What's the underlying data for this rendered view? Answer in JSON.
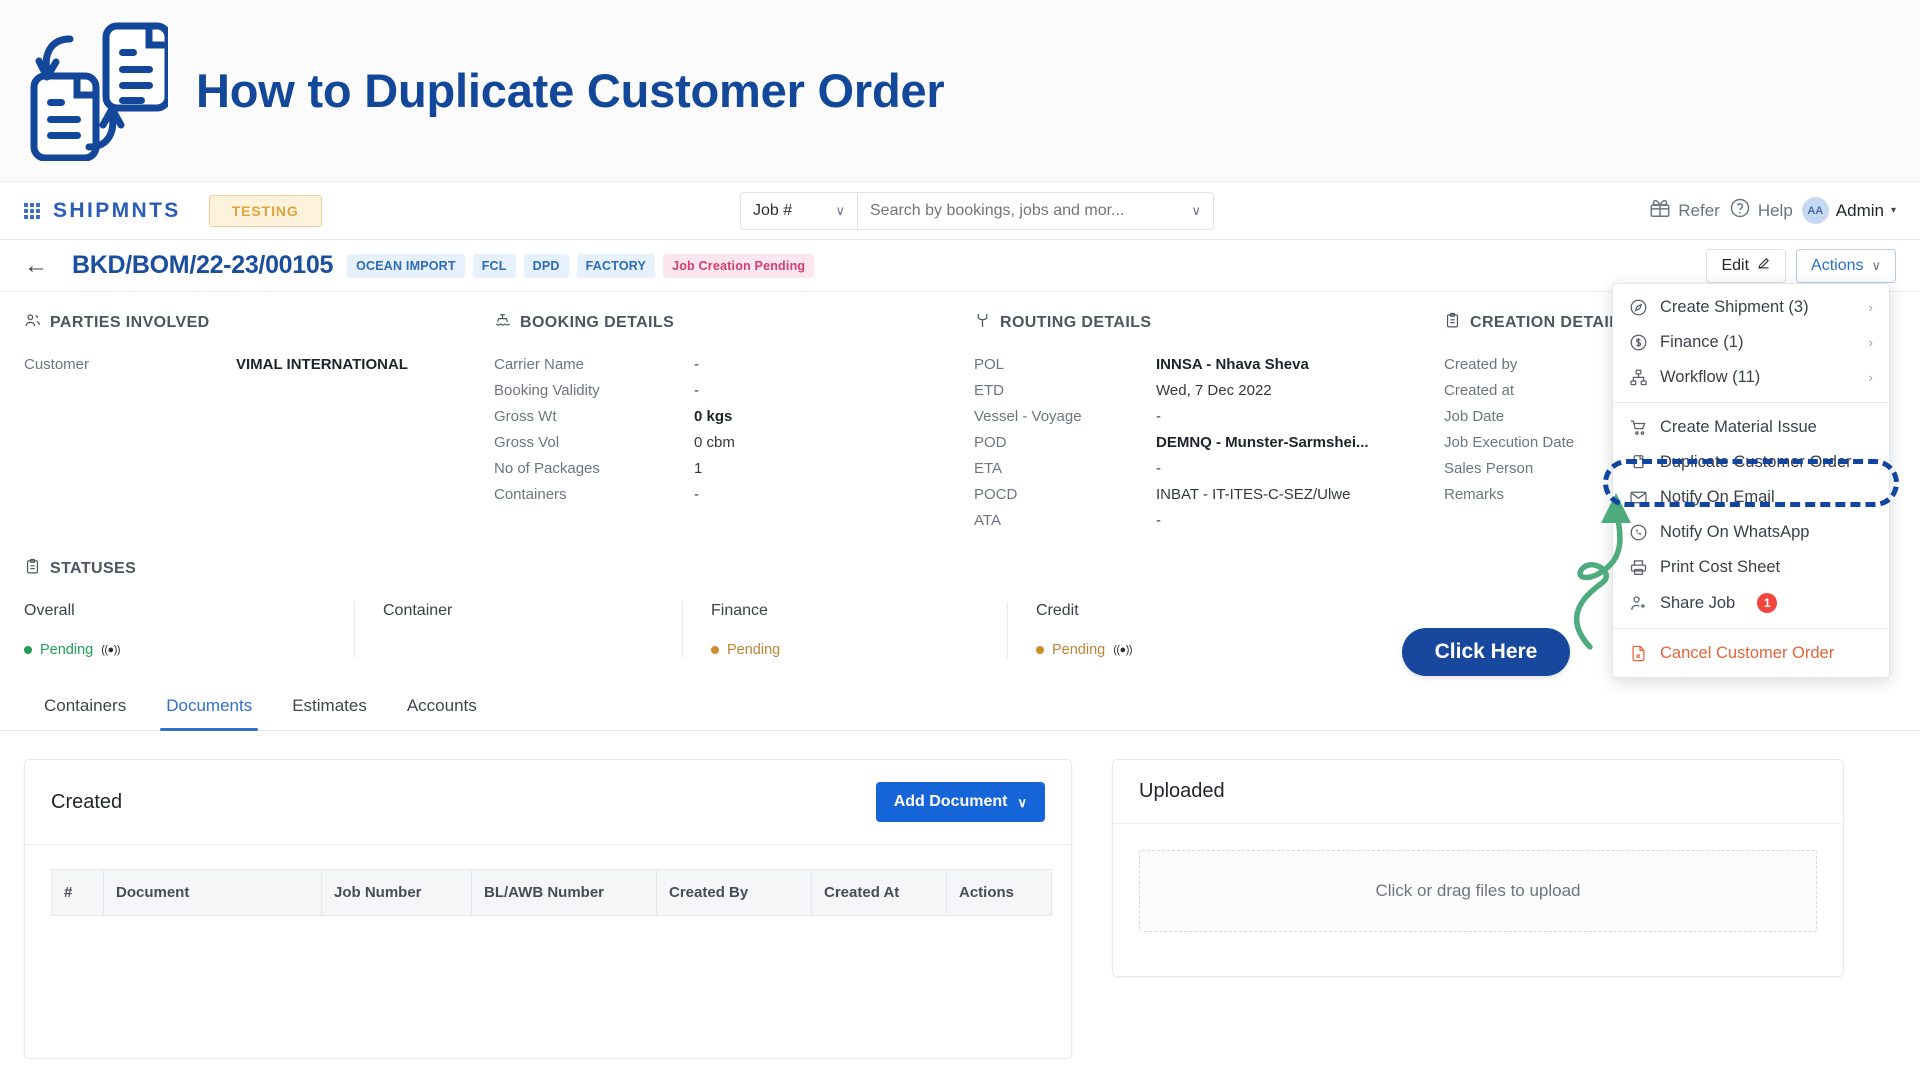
{
  "banner": {
    "title": "How to Duplicate Customer Order",
    "icon": "duplicate-documents-icon"
  },
  "topnav": {
    "apps_icon": "grid-apps-icon",
    "brand": "SHIPMNTS",
    "env_badge": "TESTING",
    "search": {
      "scope_label": "Job #",
      "scope_caret": "∨",
      "placeholder": "Search by bookings, jobs and mor...",
      "value": "",
      "caret": "∨"
    },
    "refer_label": "Refer",
    "help_label": "Help",
    "avatar_initials": "AA",
    "user_label": "Admin",
    "user_caret": "▾"
  },
  "titlebar": {
    "back_icon": "back-arrow-icon",
    "job_number": "BKD/BOM/22-23/00105",
    "tags": [
      {
        "label": "OCEAN IMPORT",
        "style": "blue"
      },
      {
        "label": "FCL",
        "style": "blue"
      },
      {
        "label": "DPD",
        "style": "blue"
      },
      {
        "label": "FACTORY",
        "style": "blue"
      },
      {
        "label": "Job Creation Pending",
        "style": "pink"
      }
    ],
    "edit_label": "Edit",
    "actions_label": "Actions",
    "actions_caret": "∨"
  },
  "parties": {
    "heading": "PARTIES INVOLVED",
    "rows": [
      {
        "key": "Customer",
        "value": "VIMAL INTERNATIONAL",
        "bold": true
      }
    ]
  },
  "booking": {
    "heading": "BOOKING DETAILS",
    "rows": [
      {
        "key": "Carrier Name",
        "value": "-",
        "bold": false
      },
      {
        "key": "Booking Validity",
        "value": "-",
        "bold": false
      },
      {
        "key": "Gross Wt",
        "value": "0 kgs",
        "bold": true
      },
      {
        "key": "Gross Vol",
        "value": "0 cbm",
        "bold": false
      },
      {
        "key": "No of Packages",
        "value": "1",
        "bold": false
      },
      {
        "key": "Containers",
        "value": "-",
        "bold": false
      }
    ]
  },
  "routing": {
    "heading": "ROUTING DETAILS",
    "rows": [
      {
        "key": "POL",
        "value": "INNSA - Nhava Sheva",
        "bold": true
      },
      {
        "key": "ETD",
        "value": "Wed, 7 Dec 2022",
        "bold": false
      },
      {
        "key": "Vessel - Voyage",
        "value": "-",
        "bold": false
      },
      {
        "key": "POD",
        "value": "DEMNQ - Munster-Sarmshei...",
        "bold": true
      },
      {
        "key": "ETA",
        "value": "-",
        "bold": false
      },
      {
        "key": "POCD",
        "value": "INBAT - IT-ITES-C-SEZ/Ulwe",
        "bold": false
      },
      {
        "key": "ATA",
        "value": "-",
        "bold": false
      }
    ]
  },
  "creation": {
    "heading": "CREATION DETAIL",
    "rows": [
      {
        "key": "Created by",
        "value": "",
        "bold": false
      },
      {
        "key": "Created at",
        "value": "",
        "bold": false
      },
      {
        "key": "Job Date",
        "value": "",
        "bold": false
      },
      {
        "key": "Job Execution Date",
        "value": "",
        "bold": false
      },
      {
        "key": "Sales Person",
        "value": "",
        "bold": false
      },
      {
        "key": "Remarks",
        "value": "",
        "bold": false
      }
    ]
  },
  "statuses": {
    "heading": "STATUSES",
    "cells": [
      {
        "label": "Overall",
        "value": "Pending",
        "color": "green",
        "signal": true
      },
      {
        "label": "Container",
        "value": "",
        "color": "none",
        "signal": false
      },
      {
        "label": "Finance",
        "value": "Pending",
        "color": "amber",
        "signal": false
      },
      {
        "label": "Credit",
        "value": "Pending",
        "color": "amber",
        "signal": true
      }
    ]
  },
  "tabs": [
    {
      "label": "Containers",
      "active": false
    },
    {
      "label": "Documents",
      "active": true
    },
    {
      "label": "Estimates",
      "active": false
    },
    {
      "label": "Accounts",
      "active": false
    }
  ],
  "created_card": {
    "title": "Created",
    "add_button": "Add Document",
    "add_caret": "∨",
    "columns": [
      "#",
      "Document",
      "Job Number",
      "BL/AWB Number",
      "Created By",
      "Created At",
      "Actions"
    ],
    "rows": []
  },
  "uploaded_card": {
    "title": "Uploaded",
    "dropzone_text": "Click or drag files to upload"
  },
  "actions_menu": {
    "items": [
      {
        "label": "Create Shipment (3)",
        "icon": "compass-icon",
        "submenu": true,
        "badge": null,
        "danger": false
      },
      {
        "label": "Finance (1)",
        "icon": "dollar-icon",
        "submenu": true,
        "badge": null,
        "danger": false
      },
      {
        "label": "Workflow (11)",
        "icon": "sitemap-icon",
        "submenu": true,
        "badge": null,
        "danger": false
      },
      {
        "label": "Create Material Issue",
        "icon": "cart-icon",
        "submenu": false,
        "badge": null,
        "danger": false
      },
      {
        "label": "Duplicate Customer Order",
        "icon": "copy-icon",
        "submenu": false,
        "badge": null,
        "danger": false,
        "highlighted": true
      },
      {
        "label": "Notify On Email",
        "icon": "envelope-icon",
        "submenu": false,
        "badge": null,
        "danger": false
      },
      {
        "label": "Notify On WhatsApp",
        "icon": "whatsapp-icon",
        "submenu": false,
        "badge": null,
        "danger": false
      },
      {
        "label": "Print Cost Sheet",
        "icon": "printer-icon",
        "submenu": false,
        "badge": null,
        "danger": false
      },
      {
        "label": "Share Job",
        "icon": "share-user-icon",
        "submenu": false,
        "badge": "1",
        "danger": false
      },
      {
        "label": "Cancel Customer Order",
        "icon": "file-cancel-icon",
        "submenu": false,
        "badge": null,
        "danger": true
      }
    ],
    "submenu_chevron": "›"
  },
  "callout": {
    "button_label": "Click Here",
    "arrow": "curved-arrow-icon",
    "highlight_color": "#1046a0",
    "arrow_color": "#4dab7d"
  },
  "colors": {
    "brand_blue": "#2a5cb8",
    "accent_blue": "#1665d8",
    "title_blue": "#12479a",
    "pink_badge": "#d63b73",
    "green_status": "#1f9c5a",
    "amber_status": "#bd8436",
    "danger": "#e2663b",
    "badge_red": "#f2453d"
  }
}
